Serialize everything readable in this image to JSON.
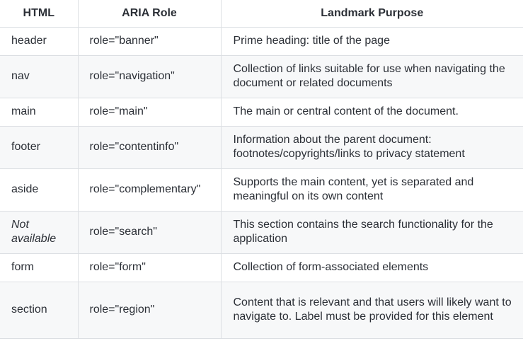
{
  "table": {
    "headers": [
      "HTML",
      "ARIA Role",
      "Landmark Purpose"
    ],
    "rows": [
      {
        "html": "header",
        "role": "role=\"banner\"",
        "purpose": "Prime heading: title of the page",
        "italic": false
      },
      {
        "html": "nav",
        "role": "role=\"navigation\"",
        "purpose": "Collection of links suitable for use when navigating the document or related documents",
        "italic": false
      },
      {
        "html": "main",
        "role": "role=\"main\"",
        "purpose": "The main or central content of the document.",
        "italic": false
      },
      {
        "html": "footer",
        "role": "role=\"contentinfo\"",
        "purpose": "Information about the parent document: footnotes/copyrights/links to privacy statement",
        "italic": false
      },
      {
        "html": "aside",
        "role": "role=\"complementary\"",
        "purpose": "Supports the main content, yet is separated and meaningful on its own content",
        "italic": false
      },
      {
        "html": "Not available",
        "role": "role=\"search\"",
        "purpose": "This section contains the search functionality for the application",
        "italic": true
      },
      {
        "html": "form",
        "role": "role=\"form\"",
        "purpose": "Collection of form-associated elements",
        "italic": false
      },
      {
        "html": "section",
        "role": "role=\"region\"",
        "purpose": "Content that is relevant and that users will likely want to navigate to. Label must be provided for this element",
        "italic": false
      }
    ]
  }
}
